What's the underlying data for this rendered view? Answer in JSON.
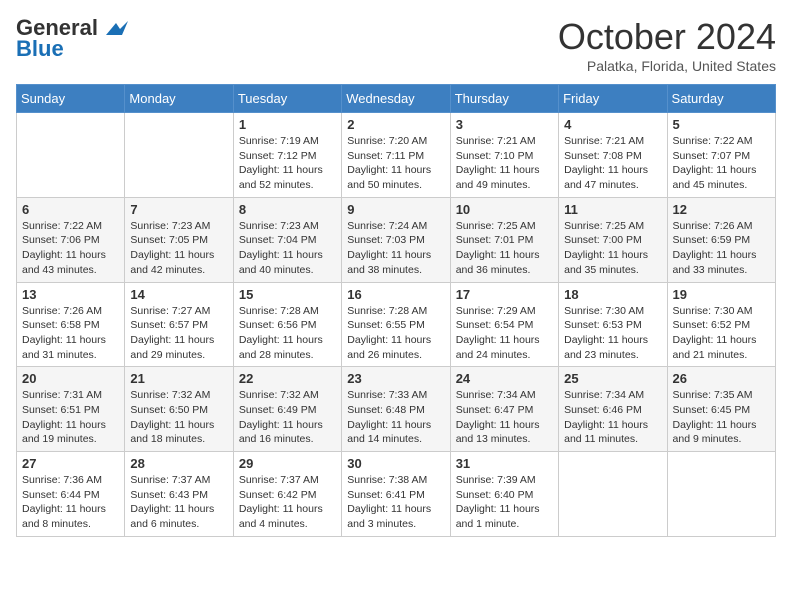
{
  "header": {
    "logo_line1": "General",
    "logo_line2": "Blue",
    "month": "October 2024",
    "location": "Palatka, Florida, United States"
  },
  "weekdays": [
    "Sunday",
    "Monday",
    "Tuesday",
    "Wednesday",
    "Thursday",
    "Friday",
    "Saturday"
  ],
  "weeks": [
    [
      null,
      null,
      {
        "day": 1,
        "sunrise": "7:19 AM",
        "sunset": "7:12 PM",
        "daylight": "11 hours and 52 minutes."
      },
      {
        "day": 2,
        "sunrise": "7:20 AM",
        "sunset": "7:11 PM",
        "daylight": "11 hours and 50 minutes."
      },
      {
        "day": 3,
        "sunrise": "7:21 AM",
        "sunset": "7:10 PM",
        "daylight": "11 hours and 49 minutes."
      },
      {
        "day": 4,
        "sunrise": "7:21 AM",
        "sunset": "7:08 PM",
        "daylight": "11 hours and 47 minutes."
      },
      {
        "day": 5,
        "sunrise": "7:22 AM",
        "sunset": "7:07 PM",
        "daylight": "11 hours and 45 minutes."
      }
    ],
    [
      {
        "day": 6,
        "sunrise": "7:22 AM",
        "sunset": "7:06 PM",
        "daylight": "11 hours and 43 minutes."
      },
      {
        "day": 7,
        "sunrise": "7:23 AM",
        "sunset": "7:05 PM",
        "daylight": "11 hours and 42 minutes."
      },
      {
        "day": 8,
        "sunrise": "7:23 AM",
        "sunset": "7:04 PM",
        "daylight": "11 hours and 40 minutes."
      },
      {
        "day": 9,
        "sunrise": "7:24 AM",
        "sunset": "7:03 PM",
        "daylight": "11 hours and 38 minutes."
      },
      {
        "day": 10,
        "sunrise": "7:25 AM",
        "sunset": "7:01 PM",
        "daylight": "11 hours and 36 minutes."
      },
      {
        "day": 11,
        "sunrise": "7:25 AM",
        "sunset": "7:00 PM",
        "daylight": "11 hours and 35 minutes."
      },
      {
        "day": 12,
        "sunrise": "7:26 AM",
        "sunset": "6:59 PM",
        "daylight": "11 hours and 33 minutes."
      }
    ],
    [
      {
        "day": 13,
        "sunrise": "7:26 AM",
        "sunset": "6:58 PM",
        "daylight": "11 hours and 31 minutes."
      },
      {
        "day": 14,
        "sunrise": "7:27 AM",
        "sunset": "6:57 PM",
        "daylight": "11 hours and 29 minutes."
      },
      {
        "day": 15,
        "sunrise": "7:28 AM",
        "sunset": "6:56 PM",
        "daylight": "11 hours and 28 minutes."
      },
      {
        "day": 16,
        "sunrise": "7:28 AM",
        "sunset": "6:55 PM",
        "daylight": "11 hours and 26 minutes."
      },
      {
        "day": 17,
        "sunrise": "7:29 AM",
        "sunset": "6:54 PM",
        "daylight": "11 hours and 24 minutes."
      },
      {
        "day": 18,
        "sunrise": "7:30 AM",
        "sunset": "6:53 PM",
        "daylight": "11 hours and 23 minutes."
      },
      {
        "day": 19,
        "sunrise": "7:30 AM",
        "sunset": "6:52 PM",
        "daylight": "11 hours and 21 minutes."
      }
    ],
    [
      {
        "day": 20,
        "sunrise": "7:31 AM",
        "sunset": "6:51 PM",
        "daylight": "11 hours and 19 minutes."
      },
      {
        "day": 21,
        "sunrise": "7:32 AM",
        "sunset": "6:50 PM",
        "daylight": "11 hours and 18 minutes."
      },
      {
        "day": 22,
        "sunrise": "7:32 AM",
        "sunset": "6:49 PM",
        "daylight": "11 hours and 16 minutes."
      },
      {
        "day": 23,
        "sunrise": "7:33 AM",
        "sunset": "6:48 PM",
        "daylight": "11 hours and 14 minutes."
      },
      {
        "day": 24,
        "sunrise": "7:34 AM",
        "sunset": "6:47 PM",
        "daylight": "11 hours and 13 minutes."
      },
      {
        "day": 25,
        "sunrise": "7:34 AM",
        "sunset": "6:46 PM",
        "daylight": "11 hours and 11 minutes."
      },
      {
        "day": 26,
        "sunrise": "7:35 AM",
        "sunset": "6:45 PM",
        "daylight": "11 hours and 9 minutes."
      }
    ],
    [
      {
        "day": 27,
        "sunrise": "7:36 AM",
        "sunset": "6:44 PM",
        "daylight": "11 hours and 8 minutes."
      },
      {
        "day": 28,
        "sunrise": "7:37 AM",
        "sunset": "6:43 PM",
        "daylight": "11 hours and 6 minutes."
      },
      {
        "day": 29,
        "sunrise": "7:37 AM",
        "sunset": "6:42 PM",
        "daylight": "11 hours and 4 minutes."
      },
      {
        "day": 30,
        "sunrise": "7:38 AM",
        "sunset": "6:41 PM",
        "daylight": "11 hours and 3 minutes."
      },
      {
        "day": 31,
        "sunrise": "7:39 AM",
        "sunset": "6:40 PM",
        "daylight": "11 hours and 1 minute."
      },
      null,
      null
    ]
  ]
}
